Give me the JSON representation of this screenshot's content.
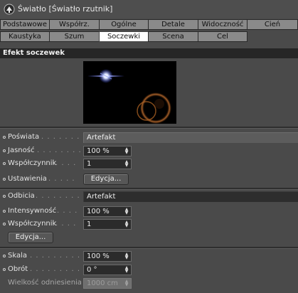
{
  "window": {
    "title": "Światło [Światło rzutnik]",
    "icon": "light-icon"
  },
  "tabs_row1": [
    {
      "label": "Podstawowe",
      "active": false
    },
    {
      "label": "Współrz.",
      "active": false
    },
    {
      "label": "Ogólne",
      "active": false
    },
    {
      "label": "Detale",
      "active": false
    },
    {
      "label": "Widoczność",
      "active": false
    },
    {
      "label": "Cień",
      "active": false
    }
  ],
  "tabs_row2": [
    {
      "label": "Kaustyka",
      "active": false
    },
    {
      "label": "Szum",
      "active": false
    },
    {
      "label": "Soczewki",
      "active": true
    },
    {
      "label": "Scena",
      "active": false
    },
    {
      "label": "Cel",
      "active": false
    }
  ],
  "section": {
    "title": "Efekt soczewek"
  },
  "glow": {
    "label": "Poświata",
    "dots": ". . . . . . . .",
    "value": "Artefakt",
    "brightness": {
      "label": "Jasność",
      "dots": ". . . . . . . . .",
      "value": "100 %"
    },
    "factor": {
      "label": "Współczynnik",
      "dots": ". . . .",
      "value": "1"
    },
    "settings": {
      "label": "Ustawienia",
      "dots": ". . . . .",
      "button": "Edycja..."
    }
  },
  "reflections": {
    "label": "Odbicia",
    "dots": ". . . . . . . . .",
    "value": "Artefakt",
    "intensity": {
      "label": "Intensywność",
      "dots": ". . . .",
      "value": "100 %"
    },
    "factor": {
      "label": "Współczynnik",
      "dots": ". . . .",
      "value": "1"
    },
    "button": "Edycja..."
  },
  "transform": {
    "scale": {
      "label": "Skala",
      "dots": ". . . . . . . . . .",
      "value": "100 %"
    },
    "rotation": {
      "label": "Obrót",
      "dots": ". . . . . . . . . .",
      "value": "0 °"
    },
    "reference_size": {
      "label": "Wielkość odniesienia",
      "value": "1000 cm"
    }
  }
}
